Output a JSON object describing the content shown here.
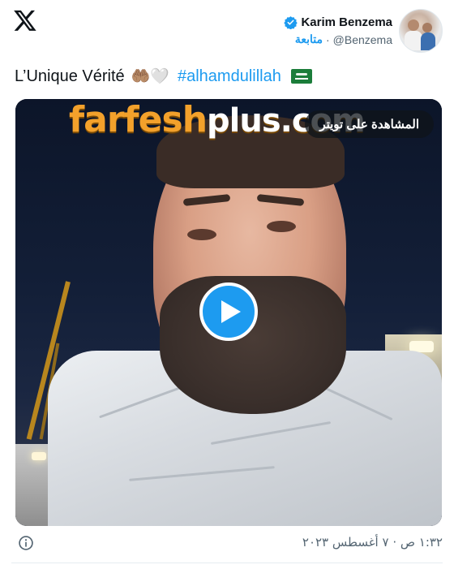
{
  "brand": {
    "logo": "x-logo-icon"
  },
  "author": {
    "display_name": "Karim Benzema",
    "handle": "@Benzema",
    "follow_label": "متابعة",
    "separator": "·",
    "verified_icon": "verified-badge-icon",
    "verified_color": "#1d9bf0"
  },
  "tweet": {
    "text": "L’Unique Vérité",
    "emojis": "🤲🏽🤍",
    "hashtag": "#alhamdulillah",
    "flag": "saudi-flag-icon"
  },
  "media": {
    "watermark_main": "farfesh",
    "watermark_suffix": "plus.com",
    "watch_label": "المشاهدة على تويتر",
    "play_icon": "play-icon",
    "play_color": "#1d9bf0"
  },
  "footer": {
    "info_icon": "info-icon",
    "timestamp": "١:٣٢ ص · ٧ أغسطس ٢٠٢٣"
  },
  "colors": {
    "accent": "#1d9bf0",
    "text": "#0f1419",
    "muted": "#536471"
  }
}
